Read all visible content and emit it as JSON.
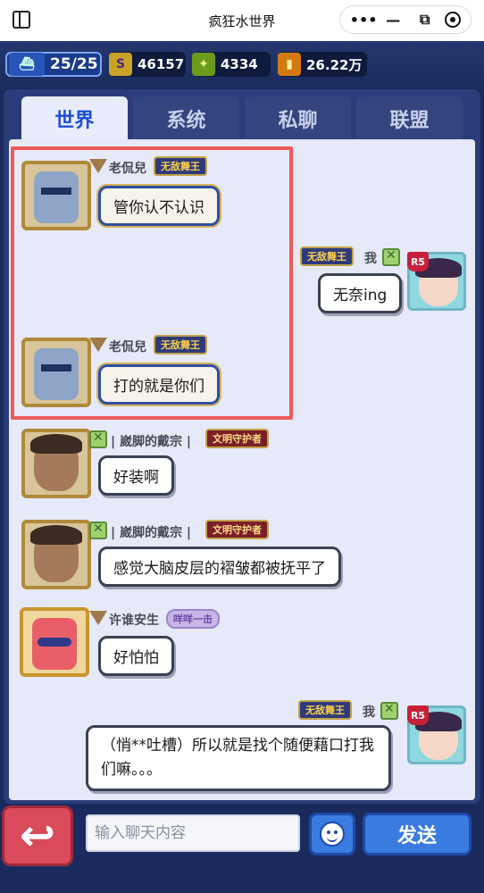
{
  "browser": {
    "title": "疯狂水世界",
    "menu_icon": "more-dots",
    "minimize_icon": "minimize",
    "restore_icon": "restore",
    "close_icon": "target-ring"
  },
  "resources": {
    "stamina": "25/25",
    "gems": "46157",
    "food": "4334",
    "gold": "26.22万"
  },
  "tabs": [
    {
      "label": "世界",
      "active": true
    },
    {
      "label": "系统",
      "active": false
    },
    {
      "label": "私聊",
      "active": false
    },
    {
      "label": "联盟",
      "active": false
    }
  ],
  "messages": [
    {
      "name": "老侃兒",
      "badge": "无敌舞王",
      "text": "管你认不认识"
    },
    {
      "name": "我",
      "badge": "无敌舞王",
      "text": "无奈ing",
      "rank": "R5"
    },
    {
      "name": "老侃兒",
      "badge": "无敌舞王",
      "text": "打的就是你们"
    },
    {
      "name": "| 崴脚的戴宗 |",
      "badge": "文明守护者",
      "text": "好装啊"
    },
    {
      "name": "| 崴脚的戴宗 |",
      "badge": "文明守护者",
      "text": "感觉大脑皮层的褶皱都被抚平了"
    },
    {
      "name": "许谁安生",
      "badge": "咩咩一击",
      "text": "好怕怕"
    },
    {
      "name": "我",
      "badge": "无敌舞王",
      "text": "（悄**吐槽）所以就是找个随便藉口打我们嘛。。。",
      "rank": "R5"
    }
  ],
  "footer": {
    "input_placeholder": "输入聊天内容",
    "send_label": "发送"
  },
  "colors": {
    "highlight": "#ee5a5a",
    "active_tab": "#1e4bd8",
    "send_button": "#3a7be0"
  }
}
